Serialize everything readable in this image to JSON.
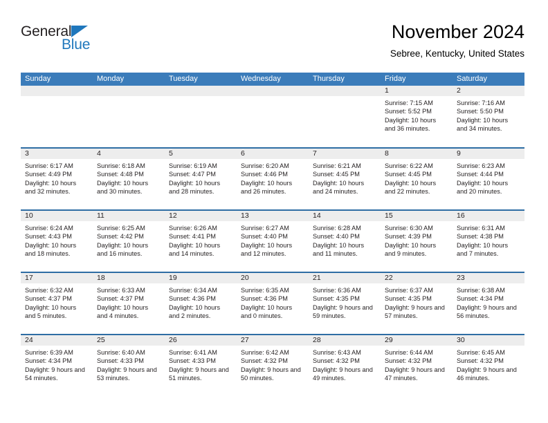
{
  "logo": {
    "word_one": "General",
    "word_two": "Blue",
    "triangle_color": "#1f77bc",
    "text_color": "#231f20"
  },
  "header": {
    "title": "November 2024",
    "subtitle": "Sebree, Kentucky, United States"
  },
  "colors": {
    "header_blue": "#3b7cba",
    "separator_blue": "#2e6da4",
    "day_band_gray": "#ededed",
    "text": "#231f20"
  },
  "calendar": {
    "weekday_headers": [
      "Sunday",
      "Monday",
      "Tuesday",
      "Wednesday",
      "Thursday",
      "Friday",
      "Saturday"
    ],
    "weeks": [
      [
        {
          "day": "",
          "empty": true
        },
        {
          "day": "",
          "empty": true
        },
        {
          "day": "",
          "empty": true
        },
        {
          "day": "",
          "empty": true
        },
        {
          "day": "",
          "empty": true
        },
        {
          "day": "1",
          "sunrise": "Sunrise: 7:15 AM",
          "sunset": "Sunset: 5:52 PM",
          "daylight": "Daylight: 10 hours and 36 minutes."
        },
        {
          "day": "2",
          "sunrise": "Sunrise: 7:16 AM",
          "sunset": "Sunset: 5:50 PM",
          "daylight": "Daylight: 10 hours and 34 minutes."
        }
      ],
      [
        {
          "day": "3",
          "sunrise": "Sunrise: 6:17 AM",
          "sunset": "Sunset: 4:49 PM",
          "daylight": "Daylight: 10 hours and 32 minutes."
        },
        {
          "day": "4",
          "sunrise": "Sunrise: 6:18 AM",
          "sunset": "Sunset: 4:48 PM",
          "daylight": "Daylight: 10 hours and 30 minutes."
        },
        {
          "day": "5",
          "sunrise": "Sunrise: 6:19 AM",
          "sunset": "Sunset: 4:47 PM",
          "daylight": "Daylight: 10 hours and 28 minutes."
        },
        {
          "day": "6",
          "sunrise": "Sunrise: 6:20 AM",
          "sunset": "Sunset: 4:46 PM",
          "daylight": "Daylight: 10 hours and 26 minutes."
        },
        {
          "day": "7",
          "sunrise": "Sunrise: 6:21 AM",
          "sunset": "Sunset: 4:45 PM",
          "daylight": "Daylight: 10 hours and 24 minutes."
        },
        {
          "day": "8",
          "sunrise": "Sunrise: 6:22 AM",
          "sunset": "Sunset: 4:45 PM",
          "daylight": "Daylight: 10 hours and 22 minutes."
        },
        {
          "day": "9",
          "sunrise": "Sunrise: 6:23 AM",
          "sunset": "Sunset: 4:44 PM",
          "daylight": "Daylight: 10 hours and 20 minutes."
        }
      ],
      [
        {
          "day": "10",
          "sunrise": "Sunrise: 6:24 AM",
          "sunset": "Sunset: 4:43 PM",
          "daylight": "Daylight: 10 hours and 18 minutes."
        },
        {
          "day": "11",
          "sunrise": "Sunrise: 6:25 AM",
          "sunset": "Sunset: 4:42 PM",
          "daylight": "Daylight: 10 hours and 16 minutes."
        },
        {
          "day": "12",
          "sunrise": "Sunrise: 6:26 AM",
          "sunset": "Sunset: 4:41 PM",
          "daylight": "Daylight: 10 hours and 14 minutes."
        },
        {
          "day": "13",
          "sunrise": "Sunrise: 6:27 AM",
          "sunset": "Sunset: 4:40 PM",
          "daylight": "Daylight: 10 hours and 12 minutes."
        },
        {
          "day": "14",
          "sunrise": "Sunrise: 6:28 AM",
          "sunset": "Sunset: 4:40 PM",
          "daylight": "Daylight: 10 hours and 11 minutes."
        },
        {
          "day": "15",
          "sunrise": "Sunrise: 6:30 AM",
          "sunset": "Sunset: 4:39 PM",
          "daylight": "Daylight: 10 hours and 9 minutes."
        },
        {
          "day": "16",
          "sunrise": "Sunrise: 6:31 AM",
          "sunset": "Sunset: 4:38 PM",
          "daylight": "Daylight: 10 hours and 7 minutes."
        }
      ],
      [
        {
          "day": "17",
          "sunrise": "Sunrise: 6:32 AM",
          "sunset": "Sunset: 4:37 PM",
          "daylight": "Daylight: 10 hours and 5 minutes."
        },
        {
          "day": "18",
          "sunrise": "Sunrise: 6:33 AM",
          "sunset": "Sunset: 4:37 PM",
          "daylight": "Daylight: 10 hours and 4 minutes."
        },
        {
          "day": "19",
          "sunrise": "Sunrise: 6:34 AM",
          "sunset": "Sunset: 4:36 PM",
          "daylight": "Daylight: 10 hours and 2 minutes."
        },
        {
          "day": "20",
          "sunrise": "Sunrise: 6:35 AM",
          "sunset": "Sunset: 4:36 PM",
          "daylight": "Daylight: 10 hours and 0 minutes."
        },
        {
          "day": "21",
          "sunrise": "Sunrise: 6:36 AM",
          "sunset": "Sunset: 4:35 PM",
          "daylight": "Daylight: 9 hours and 59 minutes."
        },
        {
          "day": "22",
          "sunrise": "Sunrise: 6:37 AM",
          "sunset": "Sunset: 4:35 PM",
          "daylight": "Daylight: 9 hours and 57 minutes."
        },
        {
          "day": "23",
          "sunrise": "Sunrise: 6:38 AM",
          "sunset": "Sunset: 4:34 PM",
          "daylight": "Daylight: 9 hours and 56 minutes."
        }
      ],
      [
        {
          "day": "24",
          "sunrise": "Sunrise: 6:39 AM",
          "sunset": "Sunset: 4:34 PM",
          "daylight": "Daylight: 9 hours and 54 minutes."
        },
        {
          "day": "25",
          "sunrise": "Sunrise: 6:40 AM",
          "sunset": "Sunset: 4:33 PM",
          "daylight": "Daylight: 9 hours and 53 minutes."
        },
        {
          "day": "26",
          "sunrise": "Sunrise: 6:41 AM",
          "sunset": "Sunset: 4:33 PM",
          "daylight": "Daylight: 9 hours and 51 minutes."
        },
        {
          "day": "27",
          "sunrise": "Sunrise: 6:42 AM",
          "sunset": "Sunset: 4:32 PM",
          "daylight": "Daylight: 9 hours and 50 minutes."
        },
        {
          "day": "28",
          "sunrise": "Sunrise: 6:43 AM",
          "sunset": "Sunset: 4:32 PM",
          "daylight": "Daylight: 9 hours and 49 minutes."
        },
        {
          "day": "29",
          "sunrise": "Sunrise: 6:44 AM",
          "sunset": "Sunset: 4:32 PM",
          "daylight": "Daylight: 9 hours and 47 minutes."
        },
        {
          "day": "30",
          "sunrise": "Sunrise: 6:45 AM",
          "sunset": "Sunset: 4:32 PM",
          "daylight": "Daylight: 9 hours and 46 minutes."
        }
      ]
    ]
  }
}
